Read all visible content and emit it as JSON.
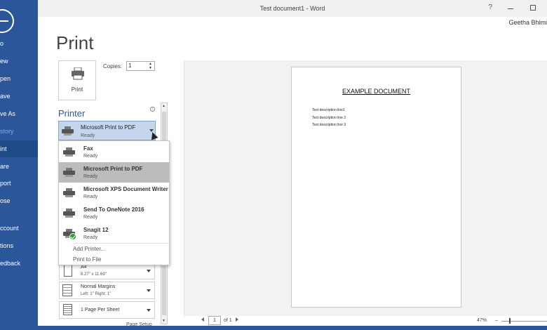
{
  "window": {
    "title": "Test document1 - Word",
    "help": "?",
    "user": "Geetha Bhimi"
  },
  "nav": {
    "items": [
      {
        "label": "o"
      },
      {
        "label": "ew"
      },
      {
        "label": "pen"
      },
      {
        "label": "ave"
      },
      {
        "label": "ve As"
      },
      {
        "label": "story"
      },
      {
        "label": "int"
      },
      {
        "label": "are"
      },
      {
        "label": "port"
      },
      {
        "label": "ose"
      },
      {
        "label": "ccount"
      },
      {
        "label": "tions"
      },
      {
        "label": "edback"
      }
    ]
  },
  "print": {
    "title": "Print",
    "button_label": "Print",
    "copies_label": "Copies:",
    "copies_value": "1",
    "printer_heading": "Printer",
    "info": "i",
    "selected_printer": {
      "name": "Microsoft Print to PDF",
      "status": "Ready"
    }
  },
  "dropdown": {
    "printers": [
      {
        "name": "Fax",
        "status": "Ready"
      },
      {
        "name": "Microsoft Print to PDF",
        "status": "Ready"
      },
      {
        "name": "Microsoft XPS Document Writer",
        "status": "Ready"
      },
      {
        "name": "Send To OneNote 2016",
        "status": "Ready"
      },
      {
        "name": "Snagit 12",
        "status": "Ready"
      }
    ],
    "add_printer": "Add Printer...",
    "print_to_file": "Print to File"
  },
  "settings": {
    "paper": {
      "main": "A4",
      "sub": "8.27\" x 11.69\""
    },
    "margins": {
      "main": "Normal Margins",
      "sub": "Left: 1\"   Right: 1\""
    },
    "pages_per_sheet": {
      "main": "1 Page Per Sheet"
    },
    "page_setup": "Page Setup"
  },
  "preview": {
    "heading": "EXAMPLE DOCUMENT",
    "lines": [
      "Test description line1",
      "Test description line 2",
      "Test description line 3"
    ]
  },
  "pager": {
    "current": "1",
    "of": "of 1",
    "zoom": "47%",
    "zoom_out": "–"
  },
  "colors": {
    "accent": "#2b579a",
    "selected_row": "#bcbcbc",
    "selected_printer_bg": "#c5d6ec"
  }
}
